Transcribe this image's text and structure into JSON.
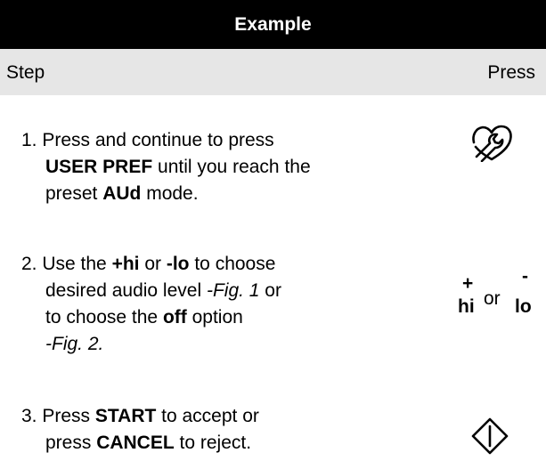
{
  "header": {
    "title": "Example"
  },
  "columns": {
    "step": "Step",
    "press": "Press"
  },
  "steps": [
    {
      "num": "1.",
      "l1": "Press and continue to press",
      "l2b": "USER PREF",
      "l2": " until you reach the",
      "l3a": "preset ",
      "l3b": "AUd",
      "l3c": " mode.",
      "icon": "wrench-heart-icon"
    },
    {
      "num": "2.",
      "l1a": "Use the ",
      "l1b": "+hi",
      "l1c": " or ",
      "l1d": "-lo",
      "l1e": " to choose",
      "l2a": "desired audio level ",
      "l2b": "-Fig. 1",
      "l2c": " or",
      "l3a": "to choose the ",
      "l3b": "off",
      "l3c": " option",
      "l4": "-Fig. 2.",
      "icon": {
        "plus": "+",
        "hi": "hi",
        "or": "or",
        "minus": "-",
        "lo": "lo"
      }
    },
    {
      "num": "3.",
      "l1a": "Press ",
      "l1b": "START",
      "l1c": " to accept or",
      "l2a": "press ",
      "l2b": "CANCEL",
      "l2c": " to reject.",
      "icon": "start-diamond-icon"
    }
  ]
}
